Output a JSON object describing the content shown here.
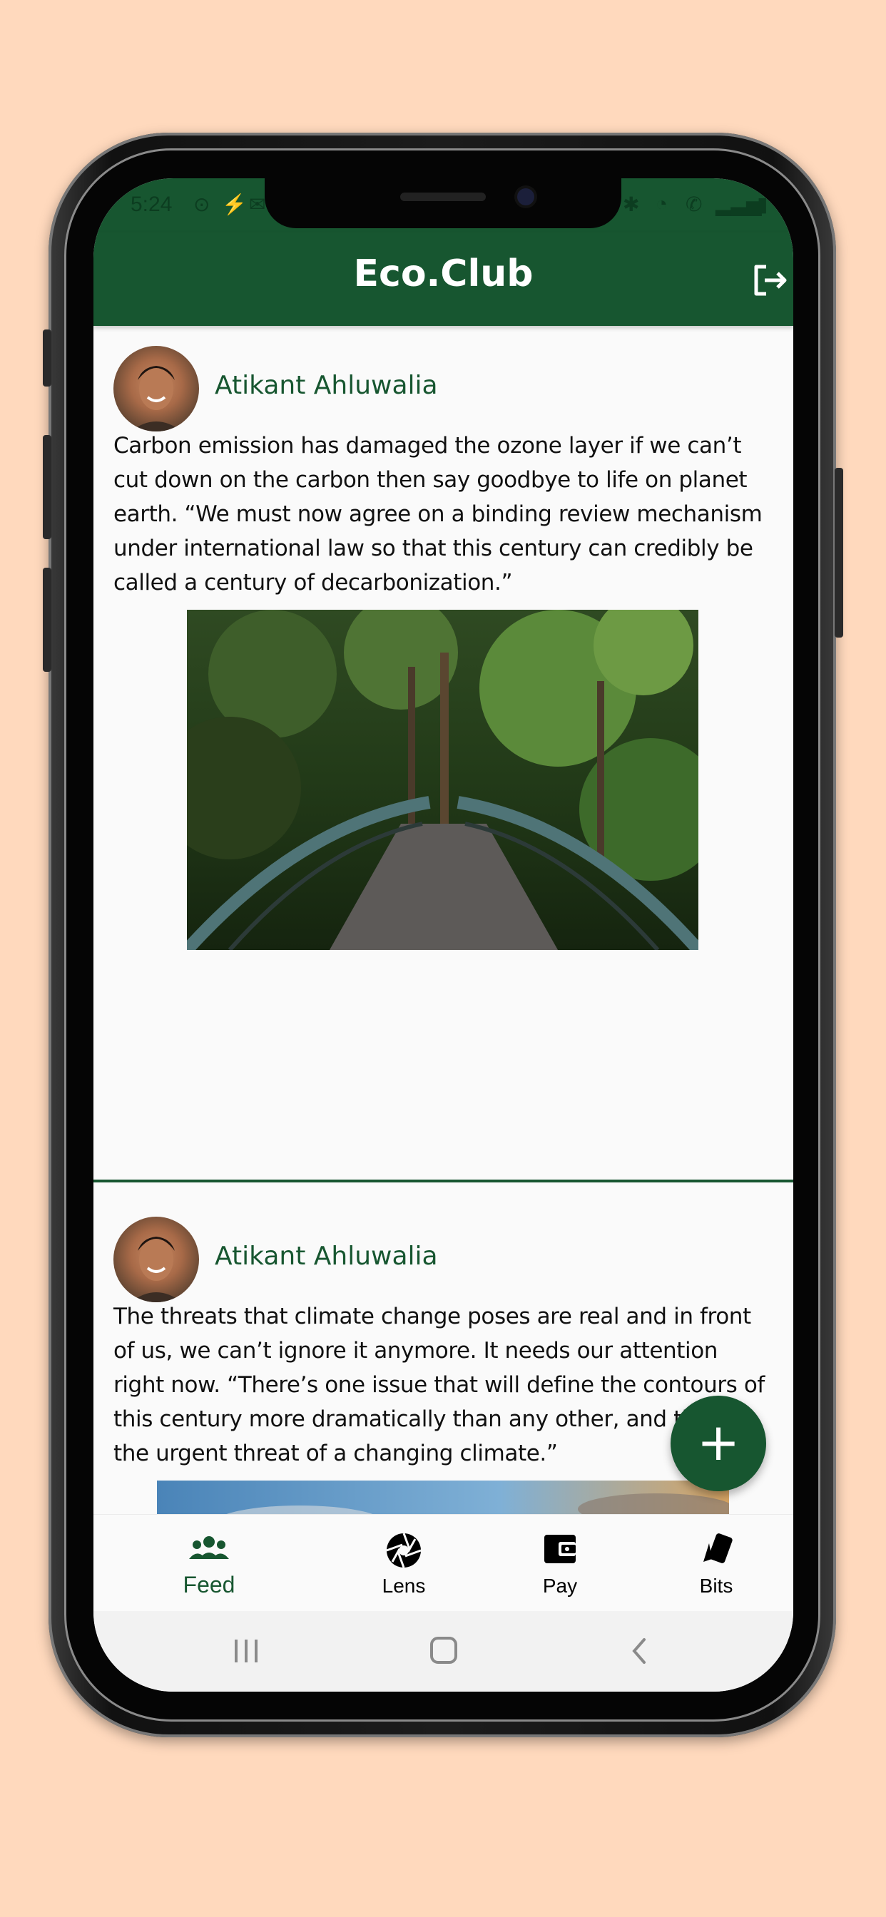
{
  "status_bar": {
    "time": "5:24"
  },
  "app_bar": {
    "title": "Eco.Club"
  },
  "posts": [
    {
      "author": "Atikant Ahluwalia",
      "text": "Carbon emission has damaged the ozone layer if we can’t cut down on the carbon then say goodbye to life on planet earth. “We must now agree on a binding review mechanism under international law so that this century can credibly be called a century of decarbonization.”"
    },
    {
      "author": "Atikant Ahluwalia",
      "text": "The threats that climate change poses are real and in front of us, we can’t ignore it anymore. It needs our attention right now. “There’s one issue that will define the contours of this century more dramatically than any other, and that is the urgent threat of a changing climate.”"
    }
  ],
  "fab": {
    "label": "+"
  },
  "bottom_nav": {
    "items": [
      {
        "label": "Feed",
        "icon": "group-icon",
        "active": true
      },
      {
        "label": "Lens",
        "icon": "camera-aperture-icon",
        "active": false
      },
      {
        "label": "Pay",
        "icon": "wallet-icon",
        "active": false
      },
      {
        "label": "Bits",
        "icon": "cards-icon",
        "active": false
      }
    ]
  },
  "colors": {
    "primary": "#175630",
    "background": "#ffd9bd",
    "surface": "#fafafa"
  }
}
